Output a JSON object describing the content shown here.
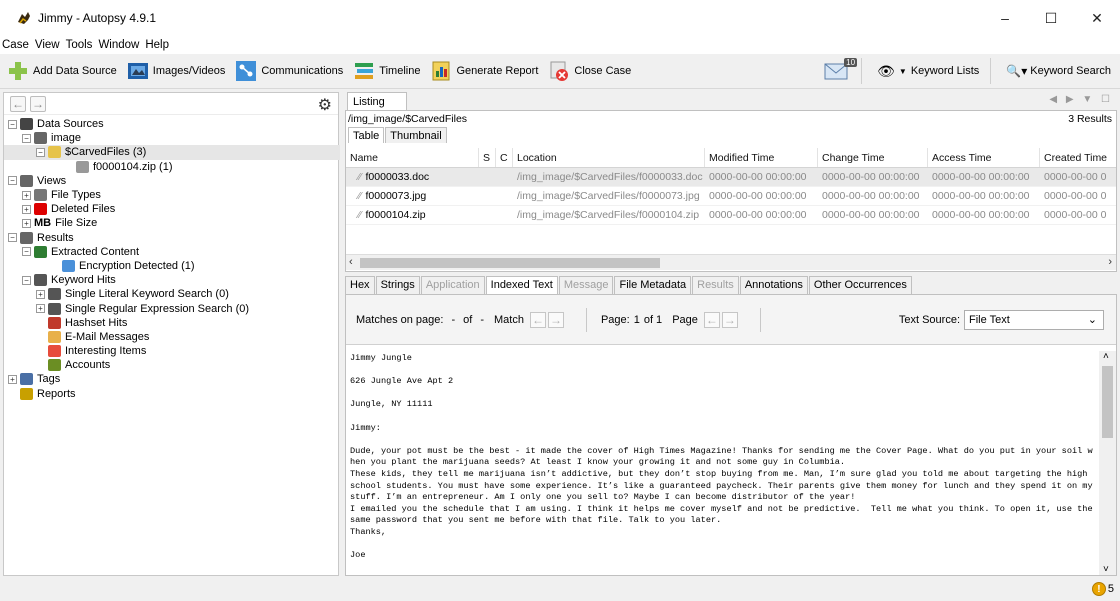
{
  "window": {
    "title": "Jimmy - Autopsy 4.9.1",
    "controls": [
      "–",
      "☐",
      "✕"
    ]
  },
  "menu": [
    "Case",
    "View",
    "Tools",
    "Window",
    "Help"
  ],
  "toolbar": {
    "add_data_source": "Add Data Source",
    "images_videos": "Images/Videos",
    "communications": "Communications",
    "timeline": "Timeline",
    "generate_report": "Generate Report",
    "close_case": "Close Case",
    "mail_badge": "10",
    "keyword_lists": "Keyword Lists",
    "keyword_search": "Keyword Search"
  },
  "tree": [
    {
      "label": "Data Sources",
      "indent": 0,
      "exp": "−",
      "icon": "drive-icon",
      "color": "#444"
    },
    {
      "label": "image",
      "indent": 1,
      "exp": "−",
      "icon": "disk-icon",
      "color": "#666"
    },
    {
      "label": "$CarvedFiles (3)",
      "indent": 2,
      "exp": "−",
      "icon": "folder-icon",
      "color": "#e6c34a",
      "selected": true
    },
    {
      "label": "f0000104.zip (1)",
      "indent": 4,
      "exp": "",
      "icon": "file-icon",
      "color": "#999"
    },
    {
      "label": "Views",
      "indent": 0,
      "exp": "−",
      "icon": "eye-icon",
      "color": "#666"
    },
    {
      "label": "File Types",
      "indent": 1,
      "exp": "+",
      "icon": "filetypes-icon",
      "color": "#777"
    },
    {
      "label": "Deleted Files",
      "indent": 1,
      "exp": "+",
      "icon": "deleted-icon",
      "color": "#d00"
    },
    {
      "label": "File Size",
      "indent": 1,
      "exp": "+",
      "icon": "mb-icon",
      "color": "#000",
      "prefix": "MB"
    },
    {
      "label": "Results",
      "indent": 0,
      "exp": "−",
      "icon": "results-icon",
      "color": "#666"
    },
    {
      "label": "Extracted Content",
      "indent": 1,
      "exp": "−",
      "icon": "extracted-icon",
      "color": "#2e7d32"
    },
    {
      "label": "Encryption Detected (1)",
      "indent": 3,
      "exp": "",
      "icon": "encryption-icon",
      "color": "#4a90d9"
    },
    {
      "label": "Keyword Hits",
      "indent": 1,
      "exp": "−",
      "icon": "keyword-search-icon",
      "color": "#555"
    },
    {
      "label": "Single Literal Keyword Search (0)",
      "indent": 2,
      "exp": "+",
      "icon": "keyword-search-icon",
      "color": "#555"
    },
    {
      "label": "Single Regular Expression Search (0)",
      "indent": 2,
      "exp": "+",
      "icon": "keyword-search-icon",
      "color": "#555"
    },
    {
      "label": "Hashset Hits",
      "indent": 2,
      "exp": "",
      "icon": "hashset-icon",
      "color": "#c0392b"
    },
    {
      "label": "E-Mail Messages",
      "indent": 2,
      "exp": "",
      "icon": "email-icon",
      "color": "#e8b04a"
    },
    {
      "label": "Interesting Items",
      "indent": 2,
      "exp": "",
      "icon": "interesting-icon",
      "color": "#e74c3c"
    },
    {
      "label": "Accounts",
      "indent": 2,
      "exp": "",
      "icon": "accounts-icon",
      "color": "#6b8e23"
    },
    {
      "label": "Tags",
      "indent": 0,
      "exp": "+",
      "icon": "tags-icon",
      "color": "#4a6fa5"
    },
    {
      "label": "Reports",
      "indent": 0,
      "exp": "",
      "icon": "reports-icon",
      "color": "#c8a000"
    }
  ],
  "listing": {
    "tab": "Listing",
    "path": "/img_image/$CarvedFiles",
    "results": "3 Results",
    "subtabs": [
      "Table",
      "Thumbnail"
    ],
    "columns": [
      "Name",
      "S",
      "C",
      "Location",
      "Modified Time",
      "Change Time",
      "Access Time",
      "Created Time"
    ],
    "rows": [
      {
        "name": "f0000033.doc",
        "location": "/img_image/$CarvedFiles/f0000033.doc",
        "modified": "0000-00-00 00:00:00",
        "change": "0000-00-00 00:00:00",
        "access": "0000-00-00 00:00:00",
        "created": "0000-00-00 0"
      },
      {
        "name": "f0000073.jpg",
        "location": "/img_image/$CarvedFiles/f0000073.jpg",
        "modified": "0000-00-00 00:00:00",
        "change": "0000-00-00 00:00:00",
        "access": "0000-00-00 00:00:00",
        "created": "0000-00-00 0"
      },
      {
        "name": "f0000104.zip",
        "location": "/img_image/$CarvedFiles/f0000104.zip",
        "modified": "0000-00-00 00:00:00",
        "change": "0000-00-00 00:00:00",
        "access": "0000-00-00 00:00:00",
        "created": "0000-00-00 0"
      }
    ]
  },
  "content_tabs": [
    {
      "label": "Hex",
      "state": "normal"
    },
    {
      "label": "Strings",
      "state": "normal"
    },
    {
      "label": "Application",
      "state": "disabled"
    },
    {
      "label": "Indexed Text",
      "state": "active"
    },
    {
      "label": "Message",
      "state": "disabled"
    },
    {
      "label": "File Metadata",
      "state": "normal"
    },
    {
      "label": "Results",
      "state": "disabled"
    },
    {
      "label": "Annotations",
      "state": "normal"
    },
    {
      "label": "Other Occurrences",
      "state": "normal"
    }
  ],
  "matchbar": {
    "matches_label": "Matches on page:",
    "matches_value": "-",
    "of": "of",
    "matches_total": "-",
    "match_label": "Match",
    "page_label": "Page:",
    "page_value": "1",
    "page_of": "of 1",
    "page_nav_label": "Page",
    "text_source_label": "Text Source:",
    "text_source_value": "File Text"
  },
  "document_text": "Jimmy Jungle\n\n626 Jungle Ave Apt 2\n\nJungle, NY 11111\n\nJimmy:\n\nDude, your pot must be the best - it made the cover of High Times Magazine! Thanks for sending me the Cover Page. What do you put in your soil when you plant the marijuana seeds? At least I know your growing it and not some guy in Columbia.\nThese kids, they tell me marijuana isn’t addictive, but they don’t stop buying from me. Man, I’m sure glad you told me about targeting the high school students. You must have some experience. It’s like a guaranteed paycheck. Their parents give them money for lunch and they spend it on my stuff. I’m an entrepreneur. Am I only one you sell to? Maybe I can become distributor of the year!\nI emailed you the schedule that I am using. I think it helps me cover myself and not be predictive.  Tell me what you think. To open it, use the same password that you sent me before with that file. Talk to you later.\nThanks,\n\nJoe",
  "status": {
    "notifications": "5"
  }
}
